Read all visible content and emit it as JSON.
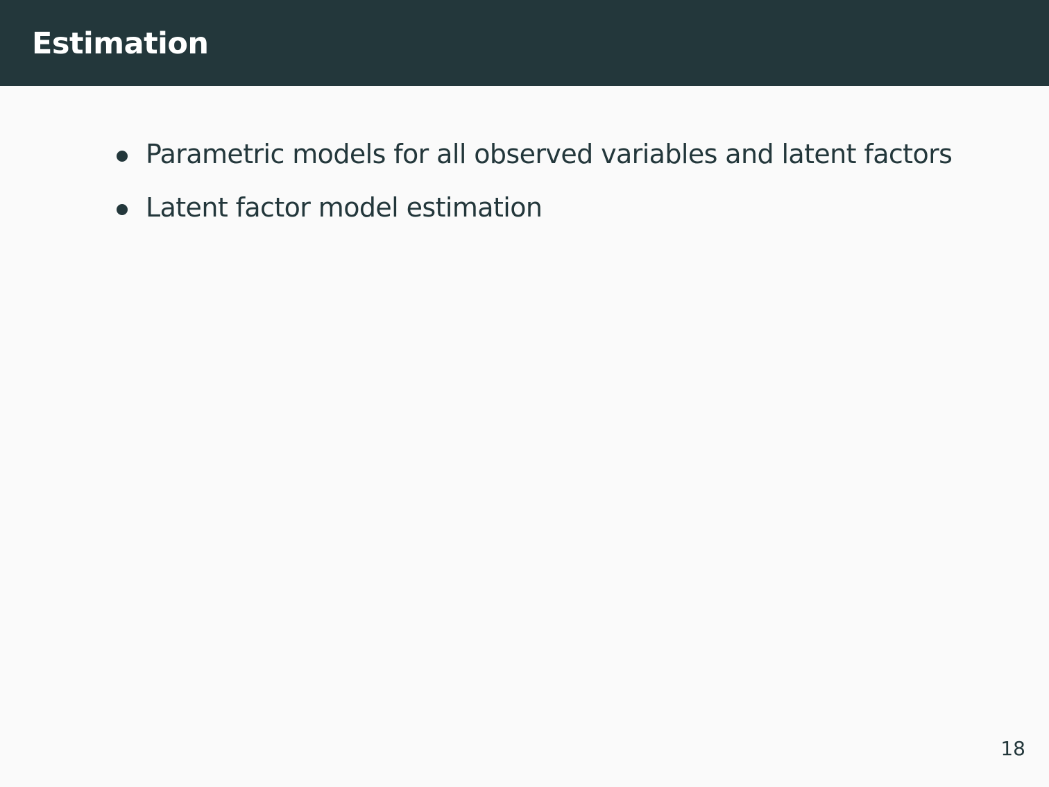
{
  "header": {
    "title": "Estimation"
  },
  "content": {
    "bullets": [
      {
        "text": "Parametric models for all observed variables and latent factors"
      },
      {
        "text": "Latent factor model estimation"
      }
    ]
  },
  "footer": {
    "page_number": "18"
  },
  "colors": {
    "header_background": "#23373b",
    "header_text": "#ffffff",
    "body_background": "#fafafa",
    "body_text": "#23373b"
  },
  "icons": {
    "bullet": "bullet-dot-icon"
  }
}
